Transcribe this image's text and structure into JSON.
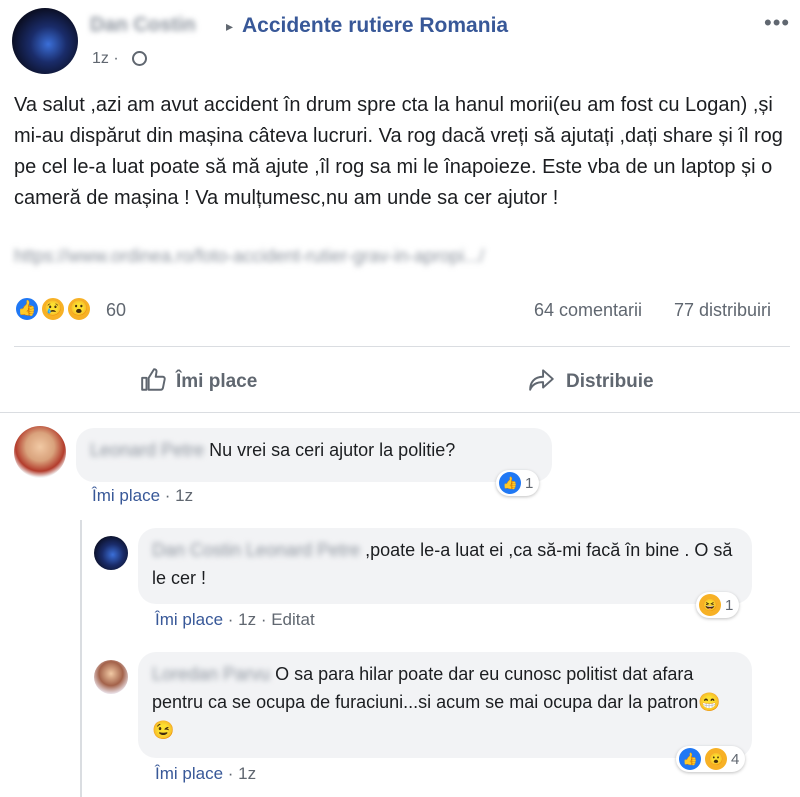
{
  "post": {
    "author": "Dan Costin",
    "separator": "▸",
    "group": "Accidente rutiere Romania",
    "time": "1z",
    "time_sep": "·",
    "more": "•••",
    "text": "Va salut ,azi am avut accident în drum spre cta la hanul morii(eu am fost cu Logan) ,și mi-au dispărut din mașina câteva lucruri. Va rog dacă vreți să ajutați ,dați share și îl rog pe cel le-a luat poate să mă ajute ,îl rog sa mi le înapoieze. Este vba de un laptop și o cameră de mașina ! Va mulțumesc,nu am unde sa cer ajutor !",
    "link": "https://www.ordinea.ro/foto-accident-rutier-grav-in-apropi.../",
    "reactions": {
      "icons": [
        "like-icon",
        "sad-icon",
        "wow-icon"
      ],
      "count": "60",
      "comments": "64 comentarii",
      "shares": "77 distribuiri"
    },
    "actions": {
      "like": "Îmi place",
      "share": "Distribuie"
    }
  },
  "comments": [
    {
      "author": "Leonard Petre",
      "text": "Nu vrei sa ceri ajutor la politie?",
      "like_label": "Îmi place",
      "meta": "· 1z",
      "reaction_count": "1"
    },
    {
      "author": "Dan Costin Leonard Petre",
      "text": ",poate le-a luat ei ,ca să-mi facă în bine . O să le cer !",
      "like_label": "Îmi place",
      "meta": "· 1z · Editat",
      "reaction_count": "1"
    },
    {
      "author": "Loredan Parvu",
      "text": "O sa para hilar poate dar eu cunosc politist dat afara pentru ca se ocupa de furaciuni...si acum se mai ocupa dar la patron😁 😉",
      "like_label": "Îmi place",
      "meta": "· 1z",
      "reaction_count": "4"
    }
  ],
  "colors": {
    "link_blue": "#385898",
    "like_blue": "#2078f4",
    "emoji_yellow": "#f7b125",
    "meta_gray": "#606770",
    "bubble_gray": "#f2f3f5"
  }
}
